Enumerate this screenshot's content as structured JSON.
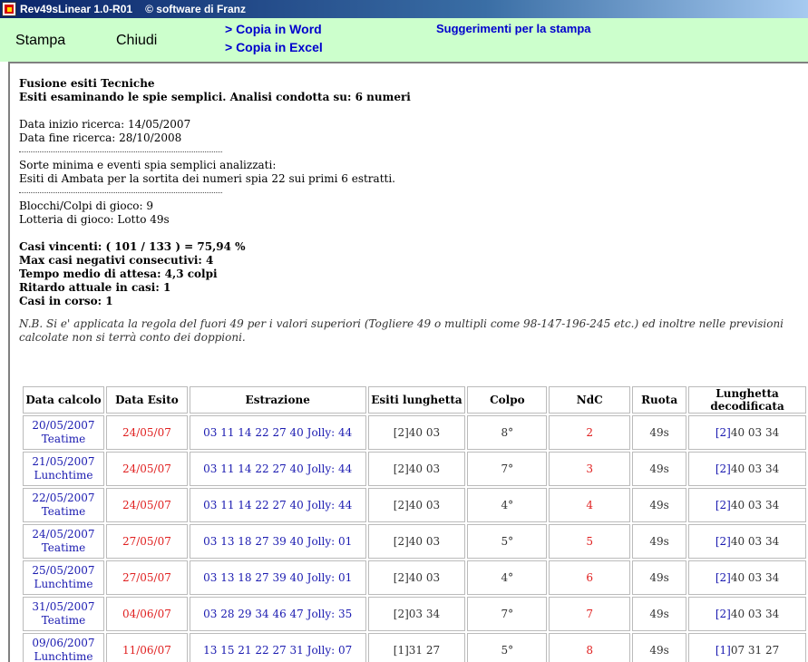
{
  "window": {
    "title": "Rev49sLinear 1.0-R01",
    "copyright": "software di Franz"
  },
  "toolbar": {
    "stampa": "Stampa",
    "chiudi": "Chiudi",
    "copia_word": "> Copia in Word",
    "copia_excel": "> Copia in Excel",
    "suggerimenti": "Suggerimenti per la stampa"
  },
  "report": {
    "heading1": "Fusione esiti Tecniche",
    "heading2": "Esiti esaminando le spie semplici. Analisi condotta su: 6 numeri",
    "data_inizio": "Data inizio ricerca: 14/05/2007",
    "data_fine": "Data fine ricerca: 28/10/2008",
    "sorte_label": "Sorte minima e eventi spia semplici analizzati:",
    "sorte_value": "Esiti di Ambata per la sortita dei numeri spia 22 sui primi 6 estratti.",
    "blocchi": "Blocchi/Colpi di gioco: 9",
    "lotteria": "Lotteria di gioco: Lotto 49s",
    "casi_vincenti": "Casi vincenti: ( 101 / 133 ) = 75,94 %",
    "max_negativi": "Max casi negativi consecutivi: 4",
    "tempo_medio": "Tempo medio di attesa: 4,3 colpi",
    "ritardo": "Ritardo attuale in casi: 1",
    "casi_corso": "Casi in corso: 1",
    "note": "N.B. Si e' applicata la regola del fuori 49 per i valori superiori (Togliere 49 o multipli come 98-147-196-245 etc.) ed inoltre nelle previsioni calcolate non si terrà conto dei doppioni."
  },
  "table": {
    "headers": [
      "Data calcolo",
      "Data Esito",
      "Estrazione",
      "Esiti lunghetta",
      "Colpo",
      "NdC",
      "Ruota",
      "Lunghetta decodificata"
    ],
    "rows": [
      {
        "data": "20/05/2007",
        "turno": "Teatime",
        "esito": "24/05/07",
        "estrazione": "03 11 14 22 27 40 Jolly: 44",
        "lunghetta": "[2]40 03",
        "colpo": "8°",
        "ndc": "2",
        "ruota": "49s",
        "dec_prefix": "[2]",
        "dec": "40 03 34"
      },
      {
        "data": "21/05/2007",
        "turno": "Lunchtime",
        "esito": "24/05/07",
        "estrazione": "03 11 14 22 27 40 Jolly: 44",
        "lunghetta": "[2]40 03",
        "colpo": "7°",
        "ndc": "3",
        "ruota": "49s",
        "dec_prefix": "[2]",
        "dec": "40 03 34"
      },
      {
        "data": "22/05/2007",
        "turno": "Teatime",
        "esito": "24/05/07",
        "estrazione": "03 11 14 22 27 40 Jolly: 44",
        "lunghetta": "[2]40 03",
        "colpo": "4°",
        "ndc": "4",
        "ruota": "49s",
        "dec_prefix": "[2]",
        "dec": "40 03 34"
      },
      {
        "data": "24/05/2007",
        "turno": "Teatime",
        "esito": "27/05/07",
        "estrazione": "03 13 18 27 39 40 Jolly: 01",
        "lunghetta": "[2]40 03",
        "colpo": "5°",
        "ndc": "5",
        "ruota": "49s",
        "dec_prefix": "[2]",
        "dec": "40 03 34"
      },
      {
        "data": "25/05/2007",
        "turno": "Lunchtime",
        "esito": "27/05/07",
        "estrazione": "03 13 18 27 39 40 Jolly: 01",
        "lunghetta": "[2]40 03",
        "colpo": "4°",
        "ndc": "6",
        "ruota": "49s",
        "dec_prefix": "[2]",
        "dec": "40 03 34"
      },
      {
        "data": "31/05/2007",
        "turno": "Teatime",
        "esito": "04/06/07",
        "estrazione": "03 28 29 34 46 47 Jolly: 35",
        "lunghetta": "[2]03 34",
        "colpo": "7°",
        "ndc": "7",
        "ruota": "49s",
        "dec_prefix": "[2]",
        "dec": "40 03 34"
      },
      {
        "data": "09/06/2007",
        "turno": "Lunchtime",
        "esito": "11/06/07",
        "estrazione": "13 15 21 22 27 31 Jolly: 07",
        "lunghetta": "[1]31 27",
        "colpo": "5°",
        "ndc": "8",
        "ruota": "49s",
        "dec_prefix": "[1]",
        "dec": "07 31 27"
      }
    ]
  }
}
